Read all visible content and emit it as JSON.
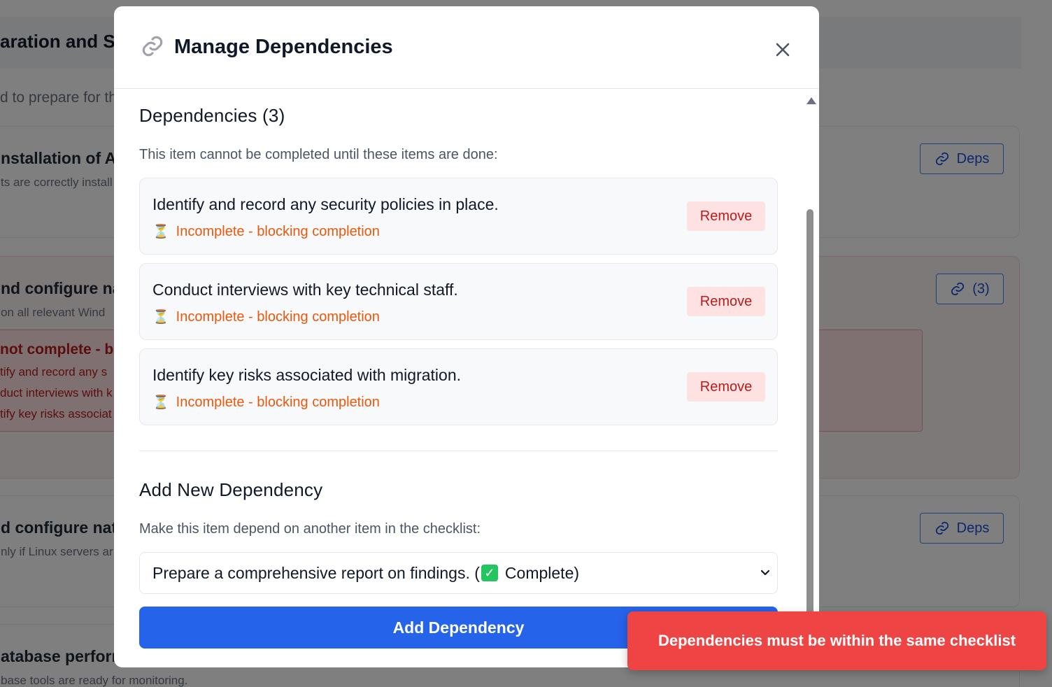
{
  "background": {
    "title": "aration and Se",
    "subtitle": "d to prepare for th",
    "cards": [
      {
        "title": "nstallation of A",
        "desc": "ts are correctly install",
        "button_label": "Deps"
      },
      {
        "title": "nd configure nat",
        "desc": "on all relevant Wind",
        "button_label": "(3)"
      },
      {
        "title": "d configure nat",
        "desc": "nly if Linux servers ar",
        "button_label": "Deps"
      },
      {
        "title": "atabase perform",
        "desc": "base tools are ready for monitoring."
      }
    ],
    "warning": {
      "title": "not complete - bl",
      "items": [
        "tify and record any s",
        "duct interviews with k",
        "tify key risks associat"
      ]
    }
  },
  "modal": {
    "icon": "link-icon",
    "title": "Manage Dependencies",
    "close_icon": "close-icon",
    "dependencies_heading": "Dependencies (3)",
    "dependencies_desc": "This item cannot be completed until these items are done:",
    "dependencies": [
      {
        "title": "Identify and record any security policies in place.",
        "status": "Incomplete - blocking completion",
        "remove_label": "Remove"
      },
      {
        "title": "Conduct interviews with key technical staff.",
        "status": "Incomplete - blocking completion",
        "remove_label": "Remove"
      },
      {
        "title": "Identify key risks associated with migration.",
        "status": "Incomplete - blocking completion",
        "remove_label": "Remove"
      }
    ],
    "add_heading": "Add New Dependency",
    "add_desc": "Make this item depend on another item in the checklist:",
    "select": {
      "value_prefix": "Prepare a comprehensive report on findings. (",
      "value_suffix": "Complete)"
    },
    "add_button_label": "Add Dependency"
  },
  "toast": {
    "message": "Dependencies must be within the same checklist"
  },
  "colors": {
    "primary": "#2563eb",
    "danger": "#ef4444",
    "warning_text": "#ea580c",
    "remove_bg": "#fee2e2"
  }
}
